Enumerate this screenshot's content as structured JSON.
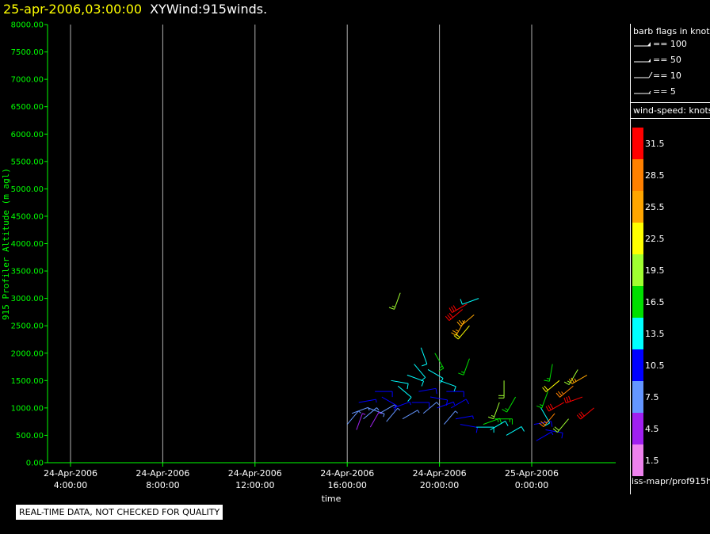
{
  "header": {
    "timestamp": "25-apr-2006,03:00:00",
    "product": "XYWind:915winds."
  },
  "chart_data": {
    "type": "scatter",
    "ylabel": "915 Profiler Altitude (m agl)",
    "xlabel": "time",
    "ylim": [
      0,
      8000
    ],
    "y_ticks": [
      "0.00",
      "500.00",
      "1000.00",
      "1500.00",
      "2000.00",
      "2500.00",
      "3000.00",
      "3500.00",
      "4000.00",
      "4500.00",
      "5000.00",
      "5500.00",
      "6000.00",
      "6500.00",
      "7000.00",
      "7500.00",
      "8000.00"
    ],
    "x_ticks": [
      {
        "date": "24-Apr-2006",
        "time": "4:00:00"
      },
      {
        "date": "24-Apr-2006",
        "time": "8:00:00"
      },
      {
        "date": "24-Apr-2006",
        "time": "12:00:00"
      },
      {
        "date": "24-Apr-2006",
        "time": "16:00:00"
      },
      {
        "date": "24-Apr-2006",
        "time": "20:00:00"
      },
      {
        "date": "25-Apr-2006",
        "time": "0:00:00"
      }
    ],
    "x_range_hours": [
      3,
      27
    ],
    "grid": "vertical",
    "series": [
      {
        "values": [
          [
            16.0,
            700,
            6,
            40
          ],
          [
            16.2,
            900,
            7,
            70
          ],
          [
            16.4,
            600,
            5,
            20
          ],
          [
            16.5,
            1100,
            9,
            80
          ],
          [
            16.7,
            800,
            6,
            50
          ],
          [
            16.9,
            1000,
            8,
            110
          ],
          [
            17.0,
            650,
            5,
            30
          ],
          [
            17.2,
            1300,
            11,
            90
          ],
          [
            17.4,
            900,
            7,
            60
          ],
          [
            17.5,
            1200,
            10,
            120
          ],
          [
            17.7,
            750,
            6,
            40
          ],
          [
            17.9,
            1500,
            12,
            100
          ],
          [
            18.0,
            1000,
            9,
            70
          ],
          [
            18.2,
            1400,
            12,
            130
          ],
          [
            18.3,
            3100,
            18,
            200
          ],
          [
            18.4,
            800,
            7,
            60
          ],
          [
            18.6,
            1600,
            13,
            110
          ],
          [
            18.8,
            1100,
            10,
            90
          ],
          [
            18.9,
            1800,
            14,
            140
          ],
          [
            19.1,
            1300,
            11,
            80
          ],
          [
            19.2,
            2100,
            12,
            160
          ],
          [
            19.3,
            900,
            8,
            50
          ],
          [
            19.5,
            1700,
            13,
            120
          ],
          [
            19.6,
            1200,
            11,
            100
          ],
          [
            19.8,
            2000,
            15,
            150
          ],
          [
            19.9,
            1000,
            9,
            70
          ],
          [
            20.0,
            1500,
            12,
            110
          ],
          [
            20.2,
            700,
            7,
            40
          ],
          [
            20.3,
            1300,
            11,
            90
          ],
          [
            20.5,
            1000,
            10,
            60
          ],
          [
            20.7,
            800,
            9,
            80
          ],
          [
            20.9,
            700,
            10,
            100
          ],
          [
            21.0,
            2800,
            30,
            230
          ],
          [
            21.1,
            2600,
            26,
            210
          ],
          [
            21.2,
            2900,
            32,
            240
          ],
          [
            21.3,
            2500,
            22,
            220
          ],
          [
            21.3,
            1900,
            17,
            200
          ],
          [
            21.5,
            2700,
            25,
            230
          ],
          [
            21.6,
            650,
            12,
            90
          ],
          [
            21.7,
            3000,
            13,
            250
          ],
          [
            21.9,
            700,
            15,
            70
          ],
          [
            22.2,
            600,
            14,
            60
          ],
          [
            22.4,
            800,
            17,
            90
          ],
          [
            22.6,
            1100,
            18,
            200
          ],
          [
            22.8,
            1500,
            20,
            180
          ],
          [
            22.9,
            500,
            13,
            60
          ],
          [
            23.3,
            1200,
            16,
            210
          ],
          [
            24.1,
            700,
            10,
            80
          ],
          [
            24.2,
            400,
            9,
            60
          ],
          [
            24.4,
            1000,
            12,
            150
          ],
          [
            24.6,
            600,
            11,
            100
          ],
          [
            24.7,
            1300,
            17,
            200
          ],
          [
            24.9,
            1800,
            15,
            190
          ],
          [
            25.0,
            900,
            27,
            220
          ],
          [
            25.2,
            1500,
            23,
            230
          ],
          [
            25.4,
            1100,
            31,
            240
          ],
          [
            25.6,
            800,
            20,
            220
          ],
          [
            25.8,
            1400,
            28,
            230
          ],
          [
            26.0,
            1700,
            19,
            210
          ],
          [
            26.2,
            1200,
            33,
            250
          ],
          [
            26.4,
            1600,
            26,
            240
          ],
          [
            26.7,
            1000,
            31,
            230
          ]
        ]
      }
    ],
    "units_note": "points: [hour since 24-Apr-2006 00:00, altitude m, wind speed knots, direction deg]"
  },
  "legend": {
    "barb_title": "barb flags in knots",
    "barb_items": [
      "== 100",
      "== 50",
      "== 10",
      "== 5"
    ],
    "speed_title": "wind-speed: knots",
    "speed_levels": [
      {
        "label": "31.5",
        "color": "#ff0000"
      },
      {
        "label": "28.5",
        "color": "#ff8000"
      },
      {
        "label": "25.5",
        "color": "#ffa500"
      },
      {
        "label": "22.5",
        "color": "#ffff00"
      },
      {
        "label": "19.5",
        "color": "#a0ff30"
      },
      {
        "label": "16.5",
        "color": "#00e000"
      },
      {
        "label": "13.5",
        "color": "#00ffff"
      },
      {
        "label": "10.5",
        "color": "#0000ff"
      },
      {
        "label": "7.5",
        "color": "#6496ff"
      },
      {
        "label": "4.5",
        "color": "#a020f0"
      },
      {
        "label": "1.5",
        "color": "#ee82ee"
      }
    ],
    "source": "iss-mapr/prof915h"
  },
  "footer": {
    "qc_notice": "REAL-TIME DATA, NOT CHECKED FOR QUALITY"
  }
}
